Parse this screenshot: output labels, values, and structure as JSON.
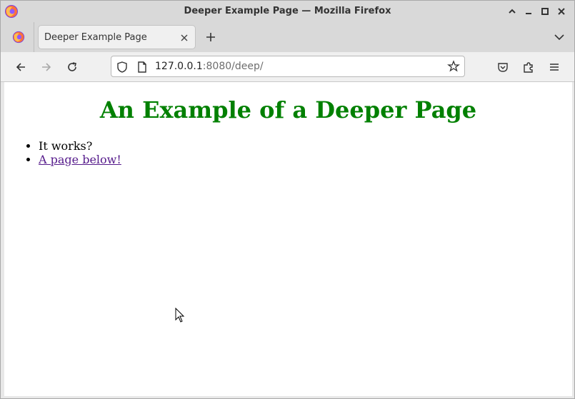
{
  "window": {
    "title": "Deeper Example Page — Mozilla Firefox"
  },
  "tabs": [
    {
      "label": "Deeper Example Page",
      "active": true
    }
  ],
  "navbar": {
    "url_host": "127.0.0.1",
    "url_rest": ":8080/deep/"
  },
  "page": {
    "heading": "An Example of a Deeper Page",
    "heading_color": "#008000",
    "list": [
      {
        "text": "It works?",
        "link": false
      },
      {
        "text": "A page below!",
        "link": true
      }
    ],
    "link_color": "#551a8b"
  },
  "icons": {
    "app": "firefox-logo-icon",
    "minimize": "minimize-icon",
    "maximize": "maximize-icon",
    "close": "close-icon",
    "back": "back-arrow-icon",
    "forward": "forward-arrow-icon",
    "reload": "reload-icon",
    "shield": "shield-icon",
    "page": "page-icon",
    "bookmark": "star-icon",
    "pocket": "pocket-icon",
    "extensions": "puzzle-icon",
    "menu": "hamburger-menu-icon"
  }
}
